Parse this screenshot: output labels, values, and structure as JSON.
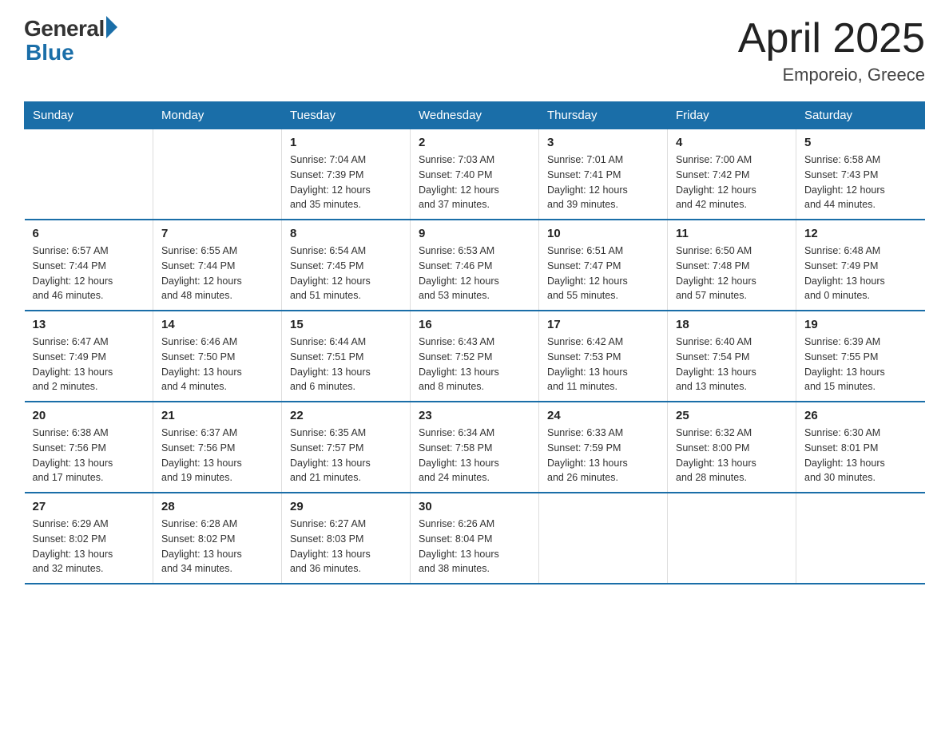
{
  "header": {
    "logo_general": "General",
    "logo_blue": "Blue",
    "title": "April 2025",
    "subtitle": "Emporeio, Greece"
  },
  "calendar": {
    "days_of_week": [
      "Sunday",
      "Monday",
      "Tuesday",
      "Wednesday",
      "Thursday",
      "Friday",
      "Saturday"
    ],
    "weeks": [
      [
        {
          "day": "",
          "info": ""
        },
        {
          "day": "",
          "info": ""
        },
        {
          "day": "1",
          "info": "Sunrise: 7:04 AM\nSunset: 7:39 PM\nDaylight: 12 hours\nand 35 minutes."
        },
        {
          "day": "2",
          "info": "Sunrise: 7:03 AM\nSunset: 7:40 PM\nDaylight: 12 hours\nand 37 minutes."
        },
        {
          "day": "3",
          "info": "Sunrise: 7:01 AM\nSunset: 7:41 PM\nDaylight: 12 hours\nand 39 minutes."
        },
        {
          "day": "4",
          "info": "Sunrise: 7:00 AM\nSunset: 7:42 PM\nDaylight: 12 hours\nand 42 minutes."
        },
        {
          "day": "5",
          "info": "Sunrise: 6:58 AM\nSunset: 7:43 PM\nDaylight: 12 hours\nand 44 minutes."
        }
      ],
      [
        {
          "day": "6",
          "info": "Sunrise: 6:57 AM\nSunset: 7:44 PM\nDaylight: 12 hours\nand 46 minutes."
        },
        {
          "day": "7",
          "info": "Sunrise: 6:55 AM\nSunset: 7:44 PM\nDaylight: 12 hours\nand 48 minutes."
        },
        {
          "day": "8",
          "info": "Sunrise: 6:54 AM\nSunset: 7:45 PM\nDaylight: 12 hours\nand 51 minutes."
        },
        {
          "day": "9",
          "info": "Sunrise: 6:53 AM\nSunset: 7:46 PM\nDaylight: 12 hours\nand 53 minutes."
        },
        {
          "day": "10",
          "info": "Sunrise: 6:51 AM\nSunset: 7:47 PM\nDaylight: 12 hours\nand 55 minutes."
        },
        {
          "day": "11",
          "info": "Sunrise: 6:50 AM\nSunset: 7:48 PM\nDaylight: 12 hours\nand 57 minutes."
        },
        {
          "day": "12",
          "info": "Sunrise: 6:48 AM\nSunset: 7:49 PM\nDaylight: 13 hours\nand 0 minutes."
        }
      ],
      [
        {
          "day": "13",
          "info": "Sunrise: 6:47 AM\nSunset: 7:49 PM\nDaylight: 13 hours\nand 2 minutes."
        },
        {
          "day": "14",
          "info": "Sunrise: 6:46 AM\nSunset: 7:50 PM\nDaylight: 13 hours\nand 4 minutes."
        },
        {
          "day": "15",
          "info": "Sunrise: 6:44 AM\nSunset: 7:51 PM\nDaylight: 13 hours\nand 6 minutes."
        },
        {
          "day": "16",
          "info": "Sunrise: 6:43 AM\nSunset: 7:52 PM\nDaylight: 13 hours\nand 8 minutes."
        },
        {
          "day": "17",
          "info": "Sunrise: 6:42 AM\nSunset: 7:53 PM\nDaylight: 13 hours\nand 11 minutes."
        },
        {
          "day": "18",
          "info": "Sunrise: 6:40 AM\nSunset: 7:54 PM\nDaylight: 13 hours\nand 13 minutes."
        },
        {
          "day": "19",
          "info": "Sunrise: 6:39 AM\nSunset: 7:55 PM\nDaylight: 13 hours\nand 15 minutes."
        }
      ],
      [
        {
          "day": "20",
          "info": "Sunrise: 6:38 AM\nSunset: 7:56 PM\nDaylight: 13 hours\nand 17 minutes."
        },
        {
          "day": "21",
          "info": "Sunrise: 6:37 AM\nSunset: 7:56 PM\nDaylight: 13 hours\nand 19 minutes."
        },
        {
          "day": "22",
          "info": "Sunrise: 6:35 AM\nSunset: 7:57 PM\nDaylight: 13 hours\nand 21 minutes."
        },
        {
          "day": "23",
          "info": "Sunrise: 6:34 AM\nSunset: 7:58 PM\nDaylight: 13 hours\nand 24 minutes."
        },
        {
          "day": "24",
          "info": "Sunrise: 6:33 AM\nSunset: 7:59 PM\nDaylight: 13 hours\nand 26 minutes."
        },
        {
          "day": "25",
          "info": "Sunrise: 6:32 AM\nSunset: 8:00 PM\nDaylight: 13 hours\nand 28 minutes."
        },
        {
          "day": "26",
          "info": "Sunrise: 6:30 AM\nSunset: 8:01 PM\nDaylight: 13 hours\nand 30 minutes."
        }
      ],
      [
        {
          "day": "27",
          "info": "Sunrise: 6:29 AM\nSunset: 8:02 PM\nDaylight: 13 hours\nand 32 minutes."
        },
        {
          "day": "28",
          "info": "Sunrise: 6:28 AM\nSunset: 8:02 PM\nDaylight: 13 hours\nand 34 minutes."
        },
        {
          "day": "29",
          "info": "Sunrise: 6:27 AM\nSunset: 8:03 PM\nDaylight: 13 hours\nand 36 minutes."
        },
        {
          "day": "30",
          "info": "Sunrise: 6:26 AM\nSunset: 8:04 PM\nDaylight: 13 hours\nand 38 minutes."
        },
        {
          "day": "",
          "info": ""
        },
        {
          "day": "",
          "info": ""
        },
        {
          "day": "",
          "info": ""
        }
      ]
    ]
  }
}
